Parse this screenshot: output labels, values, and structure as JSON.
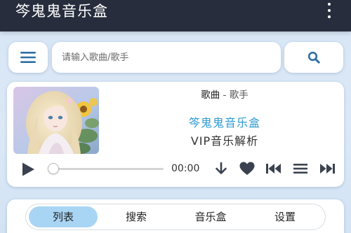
{
  "app": {
    "title": "笒鬼鬼音乐盒"
  },
  "search": {
    "placeholder": "请输入歌曲/歌手",
    "value": ""
  },
  "player": {
    "song_name": "歌曲",
    "separator": " - ",
    "artist": "歌手",
    "playlist_name": "笒鬼鬼音乐盒",
    "subtitle": "VIP音乐解析",
    "time": "00:00",
    "progress": 0
  },
  "icons": {
    "menu": "more-vertical-icon",
    "hamburger": "hamburger-icon",
    "search": "search-icon",
    "play": "play-icon",
    "download": "download-icon",
    "favorite": "heart-icon",
    "previous": "skip-previous-icon",
    "playlist": "list-icon",
    "next": "skip-next-icon"
  },
  "tabs": [
    {
      "label": "列表",
      "active": true
    },
    {
      "label": "搜索",
      "active": false
    },
    {
      "label": "音乐盒",
      "active": false
    },
    {
      "label": "设置",
      "active": false
    }
  ],
  "colors": {
    "titlebar": "#272d3d",
    "accent": "#2d9ad1",
    "icon": "#2f6fa3",
    "control": "#3a4250",
    "active_tab": "#a9d5f5"
  }
}
